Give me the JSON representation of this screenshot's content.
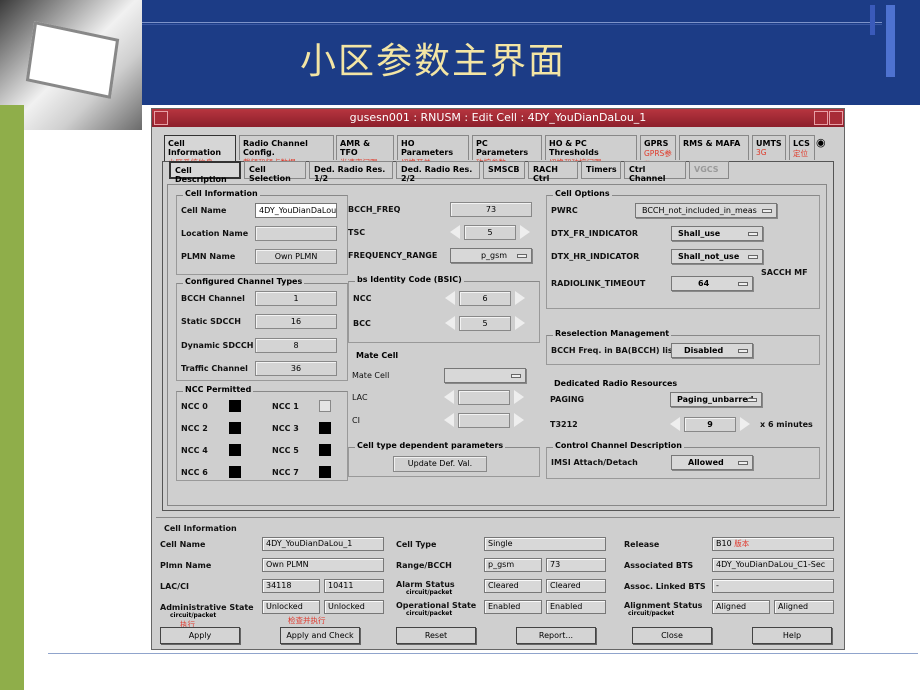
{
  "slide": {
    "title": "小区参数主界面"
  },
  "window": {
    "title": "gusesn001 : RNUSM : Edit Cell : 4DY_YouDianDaLou_1"
  },
  "tabs_main": [
    {
      "label": "Cell Information",
      "cn": "小区系统信息"
    },
    {
      "label": "Radio Channel Config.",
      "cn": "载频和频点数据"
    },
    {
      "label": "AMR & TFO",
      "cn": "半速率门限"
    },
    {
      "label": "HO Parameters",
      "cn": "切换开关"
    },
    {
      "label": "PC Parameters",
      "cn": "功控参数"
    },
    {
      "label": "HO & PC Thresholds",
      "cn": "切换和功控门限"
    },
    {
      "label": "GPRS",
      "cn": "GPRS参数"
    },
    {
      "label": "RMS & MAFA",
      "cn": ""
    },
    {
      "label": "UMTS",
      "cn": "3G"
    },
    {
      "label": "LCS",
      "cn": "定位"
    }
  ],
  "tabs_sub": [
    "Cell Description",
    "Cell Selection",
    "Ded. Radio Res. 1/2",
    "Ded. Radio Res. 2/2",
    "SMSCB",
    "RACH Ctrl",
    "Timers",
    "Ctrl Channel",
    "VGCS"
  ],
  "cell_information": {
    "group": "Cell Information",
    "cell_name_label": "Cell Name",
    "cell_name": "4DY_YouDianDaLou",
    "location_name_label": "Location Name",
    "location_name": "",
    "plmn_name_label": "PLMN Name",
    "plmn_name": "Own PLMN"
  },
  "configured_channels": {
    "group": "Configured Channel Types",
    "bcch_label": "BCCH Channel",
    "bcch": "1",
    "static_sdcch_label": "Static SDCCH",
    "static_sdcch": "16",
    "dynamic_sdcch_label": "Dynamic SDCCH",
    "dynamic_sdcch": "8",
    "traffic_label": "Traffic Channel",
    "traffic": "36"
  },
  "ncc_permitted": {
    "group": "NCC Permitted",
    "items": [
      "NCC 0",
      "NCC 1",
      "NCC 2",
      "NCC 3",
      "NCC 4",
      "NCC 5",
      "NCC 6",
      "NCC 7"
    ]
  },
  "mid": {
    "bcch_freq_label": "BCCH_FREQ",
    "bcch_freq": "73",
    "tsc_label": "TSC",
    "tsc": "5",
    "freq_range_label": "FREQUENCY_RANGE",
    "freq_range": "p_gsm",
    "bsic_group": "bs Identity Code (BSIC)",
    "ncc_label": "NCC",
    "ncc": "6",
    "bcc_label": "BCC",
    "bcc": "5",
    "mate_group": "Mate Cell",
    "mate_cell_label": "Mate Cell",
    "lac_label": "LAC",
    "ci_label": "CI",
    "celltype_group": "Cell type dependent parameters",
    "update_btn": "Update Def. Val."
  },
  "cell_options": {
    "group": "Cell Options",
    "pwrc_label": "PWRC",
    "pwrc": "BCCH_not_included_in_meas",
    "dtx_fr_label": "DTX_FR_INDICATOR",
    "dtx_fr": "Shall_use",
    "dtx_hr_label": "DTX_HR_INDICATOR",
    "dtx_hr": "Shall_not_use",
    "radiolink_label": "RADIOLINK_TIMEOUT",
    "radiolink": "64",
    "radiolink_unit": "SACCH MF"
  },
  "reselection": {
    "group": "Reselection Management",
    "label": "BCCH Freq. in BA(BCCH) list",
    "value": "Disabled"
  },
  "dedicated": {
    "group": "Dedicated Radio Resources",
    "paging_label": "PAGING",
    "paging": "Paging_unbarred",
    "t3212_label": "T3212",
    "t3212": "9",
    "t3212_unit": "x 6 minutes"
  },
  "control_channel": {
    "group": "Control Channel Description",
    "imsi_label": "IMSI Attach/Detach",
    "imsi": "Allowed"
  },
  "bottom": {
    "group": "Cell Information",
    "cell_name_label": "Cell Name",
    "cell_name": "4DY_YouDianDaLou_1",
    "cell_type_label": "Cell Type",
    "cell_type": "Single",
    "release_label": "Release",
    "release": "B10",
    "release_cn": "版本",
    "plmn_label": "Plmn Name",
    "plmn": "Own PLMN",
    "range_label": "Range/BCCH",
    "range": "p_gsm",
    "range_bcch": "73",
    "assoc_bts_label": "Associated BTS",
    "assoc_bts": "4DY_YouDianDaLou_C1-Sec",
    "lacci_label": "LAC/CI",
    "lac": "34118",
    "ci": "10411",
    "alarm_label": "Alarm Status",
    "alarm_sub": "circuit/packet",
    "alarm1": "Cleared",
    "alarm2": "Cleared",
    "linked_label": "Assoc. Linked BTS",
    "linked": "-",
    "admin_label": "Administrative State",
    "admin_sub": "circuit/packet",
    "admin1": "Unlocked",
    "admin2": "Unlocked",
    "oper_label": "Operational State",
    "oper_sub": "circuit/packet",
    "oper1": "Enabled",
    "oper2": "Enabled",
    "align_label": "Alignment Status",
    "align_sub": "circuit/packet",
    "align1": "Aligned",
    "align2": "Aligned",
    "cn_exec": "执行",
    "cn_check": "检查并执行"
  },
  "buttons": {
    "apply": "Apply",
    "apply_check": "Apply and Check",
    "reset": "Reset",
    "report": "Report...",
    "close": "Close",
    "help": "Help"
  }
}
